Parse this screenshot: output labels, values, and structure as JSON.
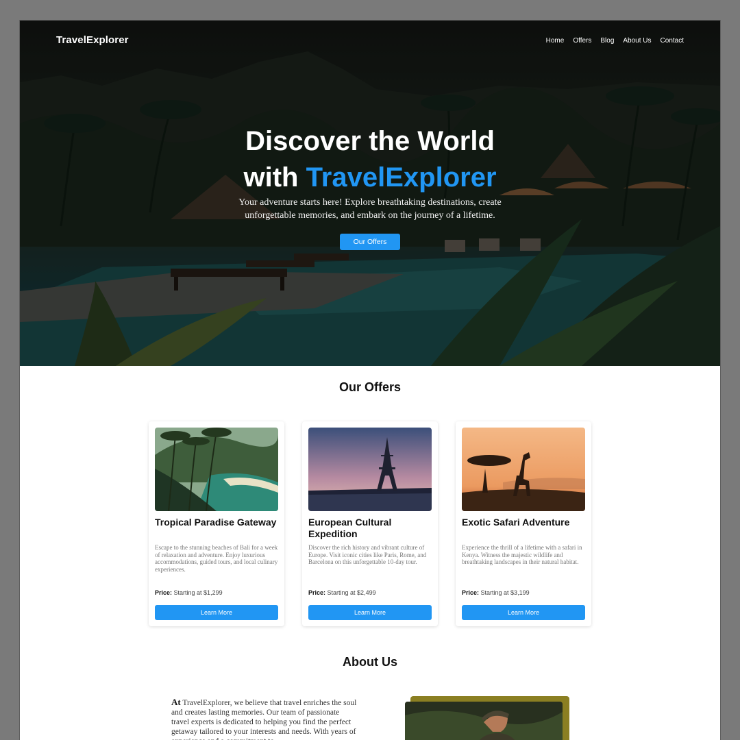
{
  "header": {
    "logo": "TravelExplorer",
    "nav": [
      "Home",
      "Offers",
      "Blog",
      "About Us",
      "Contact"
    ]
  },
  "hero": {
    "title_line1": "Discover the World",
    "title_with": "with",
    "title_accent": "TravelExplorer",
    "subtitle": "Your adventure starts here! Explore breathtaking destinations, create unforgettable memories, and embark on the journey of a lifetime.",
    "cta": "Our Offers"
  },
  "offers": {
    "title": "Our Offers",
    "cards": [
      {
        "title": "Tropical Paradise Gateway",
        "description": "Escape to the stunning beaches of Bali for a week of relaxation and adventure. Enjoy luxurious accommodations, guided tours, and local culinary experiences.",
        "price_label": "Price:",
        "price": "Starting at $1,299",
        "button": "Learn More"
      },
      {
        "title": "European Cultural Expedition",
        "description": "Discover the rich history and vibrant culture of Europe. Visit iconic cities like Paris, Rome, and Barcelona on this unforgettable 10-day tour.",
        "price_label": "Price:",
        "price": "Starting at $2,499",
        "button": "Learn More"
      },
      {
        "title": "Exotic Safari Adventure",
        "description": "Experience the thrill of a lifetime with a safari in Kenya. Witness the majestic wildlife and breathtaking landscapes in their natural habitat.",
        "price_label": "Price:",
        "price": "Starting at $3,199",
        "button": "Learn More"
      }
    ]
  },
  "about": {
    "title": "About Us",
    "lead": "At",
    "text": "TravelExplorer, we believe that travel enriches the soul and creates lasting memories. Our team of passionate travel experts is dedicated to helping you find the perfect getaway tailored to your interests and needs. With years of experience and a commitment to"
  },
  "colors": {
    "accent": "#2196f3",
    "about_frame": "#8b7f22"
  }
}
